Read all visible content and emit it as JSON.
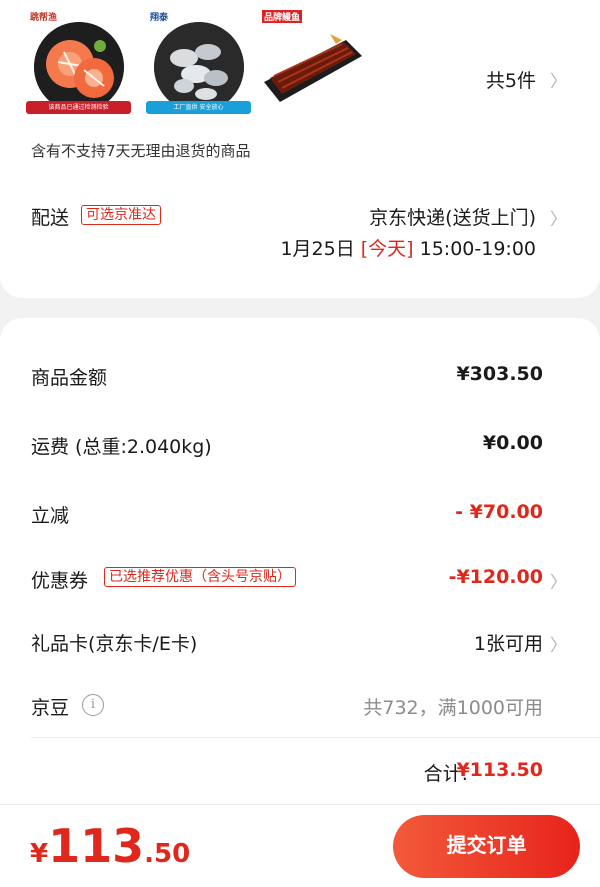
{
  "products": {
    "items": [
      {
        "logo": "跳帮渔",
        "banner": "该商品已通过检测检验"
      },
      {
        "logo": "翔泰",
        "banner": "工厂直供 安全放心"
      },
      {
        "logo": "品牌鳗鱼",
        "banner": ""
      }
    ],
    "count_label": "共5件"
  },
  "return_notice": "含有不支持7天无理由退货的商品",
  "shipping": {
    "label": "配送",
    "tag": "可选京准达",
    "method": "京东快递(送货上门)",
    "date": "1月25日",
    "day": "[今天]",
    "time": "15:00-19:00"
  },
  "summary": {
    "goods_amount": {
      "label": "商品金额",
      "value": "¥303.50"
    },
    "freight": {
      "label": "运费 (总重:2.040kg)",
      "value": "¥0.00"
    },
    "discount": {
      "label": "立减",
      "value": "- ¥70.00"
    },
    "coupon": {
      "label": "优惠券",
      "tag": "已选推荐优惠（含头号京贴）",
      "value": "-¥120.00"
    },
    "gift_card": {
      "label": "礼品卡(京东卡/E卡)",
      "value": "1张可用"
    },
    "jingdou": {
      "label": "京豆",
      "value": "共732，满1000可用"
    },
    "total_label": "合计:",
    "total_value": "¥113.50"
  },
  "bottom_bar": {
    "currency": "¥",
    "amount_int": "113",
    "amount_dec": ".50",
    "submit_label": "提交订单"
  },
  "colors": {
    "accent": "#e0271c",
    "background": "#f2f2f2"
  }
}
